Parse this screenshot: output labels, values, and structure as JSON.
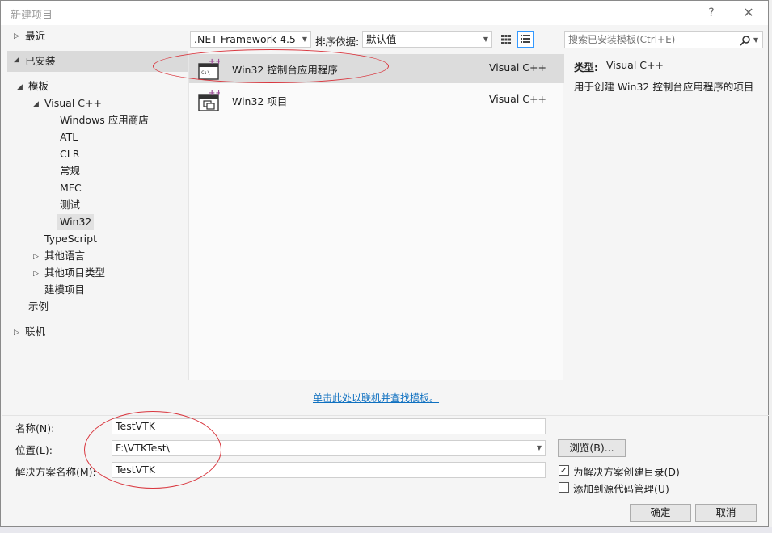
{
  "dialog": {
    "title": "新建项目",
    "help_glyph": "?",
    "close_glyph": "✕"
  },
  "tree": {
    "recent": "最近",
    "installed": "已安装",
    "templates": "模板",
    "visual_cpp": "Visual C++",
    "children": [
      "Windows 应用商店",
      "ATL",
      "CLR",
      "常规",
      "MFC",
      "测试",
      "Win32"
    ],
    "typescript": "TypeScript",
    "other_languages": "其他语言",
    "other_project_types": "其他项目类型",
    "modeling": "建模项目",
    "samples": "示例",
    "online": "联机"
  },
  "toolbar": {
    "framework": ".NET Framework 4.5",
    "sort_label": "排序依据:",
    "sort_value": "默认值"
  },
  "search": {
    "placeholder": "搜索已安装模板(Ctrl+E)"
  },
  "templates": [
    {
      "name": "Win32 控制台应用程序",
      "lang": "Visual C++",
      "icon": "console-app-icon",
      "selected": true
    },
    {
      "name": "Win32 项目",
      "lang": "Visual C++",
      "icon": "win32-project-icon",
      "selected": false
    }
  ],
  "detail": {
    "type_label": "类型:",
    "type_value": "Visual C++",
    "description": "用于创建 Win32 控制台应用程序的项目"
  },
  "online_link": "单击此处以联机并查找模板。",
  "form": {
    "name_label": "名称(N):",
    "name_value": "TestVTK",
    "location_label": "位置(L):",
    "location_value": "F:\\VTKTest\\",
    "solution_label": "解决方案名称(M):",
    "solution_value": "TestVTK",
    "browse": "浏览(B)...",
    "create_dir_label": "为解决方案创建目录(D)",
    "create_dir_checked": true,
    "source_control_label": "添加到源代码管理(U)",
    "source_control_checked": false
  },
  "buttons": {
    "ok": "确定",
    "cancel": "取消"
  },
  "colors": {
    "link": "#0e70c0",
    "annotation": "#d9363e",
    "selection": "#dcdcdc",
    "accent": "#3399ff"
  }
}
